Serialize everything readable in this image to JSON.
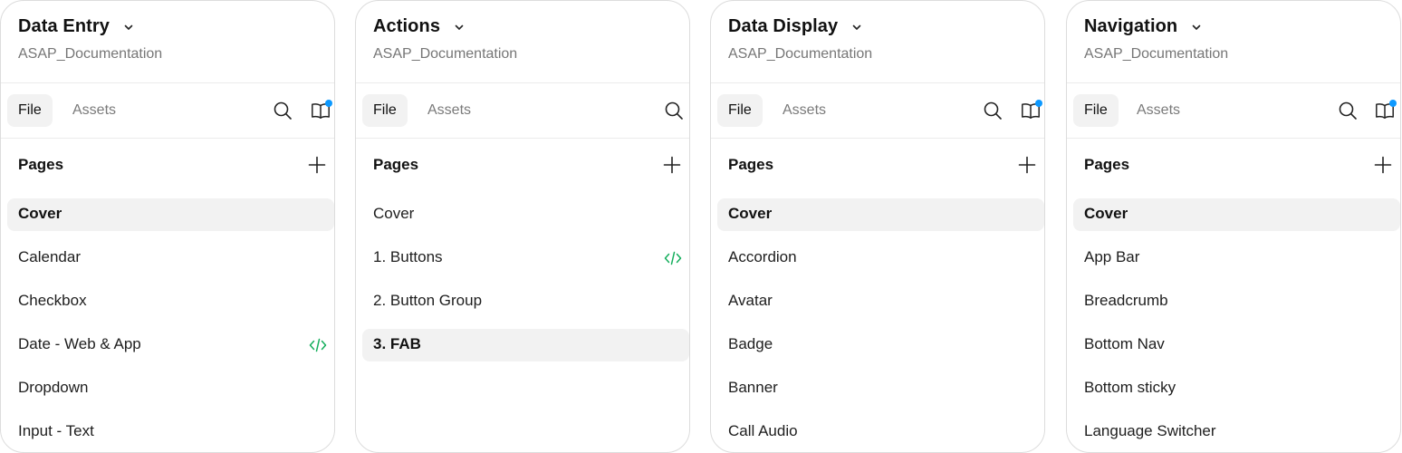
{
  "panels": [
    {
      "file_title": "Data Entry",
      "project": "ASAP_Documentation",
      "tabs": {
        "file": "File",
        "assets": "Assets"
      },
      "has_library": true,
      "pages_label": "Pages",
      "pages": [
        {
          "label": "Cover",
          "selected": true,
          "dev": false
        },
        {
          "label": "Calendar",
          "selected": false,
          "dev": false
        },
        {
          "label": "Checkbox",
          "selected": false,
          "dev": false
        },
        {
          "label": "Date - Web & App",
          "selected": false,
          "dev": true
        },
        {
          "label": "Dropdown",
          "selected": false,
          "dev": false
        },
        {
          "label": "Input - Text",
          "selected": false,
          "dev": false
        }
      ]
    },
    {
      "file_title": "Actions",
      "project": "ASAP_Documentation",
      "tabs": {
        "file": "File",
        "assets": "Assets"
      },
      "has_library": false,
      "pages_label": "Pages",
      "pages": [
        {
          "label": "Cover",
          "selected": false,
          "dev": false
        },
        {
          "label": "1. Buttons",
          "selected": false,
          "dev": true
        },
        {
          "label": "2. Button Group",
          "selected": false,
          "dev": false
        },
        {
          "label": "3. FAB",
          "selected": true,
          "dev": false
        }
      ]
    },
    {
      "file_title": "Data Display",
      "project": "ASAP_Documentation",
      "tabs": {
        "file": "File",
        "assets": "Assets"
      },
      "has_library": true,
      "pages_label": "Pages",
      "pages": [
        {
          "label": "Cover",
          "selected": true,
          "dev": false
        },
        {
          "label": "Accordion",
          "selected": false,
          "dev": false
        },
        {
          "label": "Avatar",
          "selected": false,
          "dev": false
        },
        {
          "label": "Badge",
          "selected": false,
          "dev": false
        },
        {
          "label": "Banner",
          "selected": false,
          "dev": false
        },
        {
          "label": "Call Audio",
          "selected": false,
          "dev": false
        }
      ]
    },
    {
      "file_title": "Navigation",
      "project": "ASAP_Documentation",
      "tabs": {
        "file": "File",
        "assets": "Assets"
      },
      "has_library": true,
      "pages_label": "Pages",
      "pages": [
        {
          "label": "Cover",
          "selected": true,
          "dev": false
        },
        {
          "label": "App Bar",
          "selected": false,
          "dev": false
        },
        {
          "label": "Breadcrumb",
          "selected": false,
          "dev": false
        },
        {
          "label": "Bottom Nav",
          "selected": false,
          "dev": false
        },
        {
          "label": "Bottom sticky",
          "selected": false,
          "dev": false
        },
        {
          "label": "Language Switcher",
          "selected": false,
          "dev": false
        }
      ]
    }
  ],
  "icons": {
    "title_dropdown": "chevron-down-icon",
    "search": "search-icon",
    "library": "library-book-icon",
    "add_page": "plus-icon",
    "dev_mode": "code-icon"
  },
  "colors": {
    "notification_dot": "#0d99ff",
    "dev_code": "#14ae5c",
    "selected_bg": "#f2f2f2",
    "muted_text": "#767676"
  }
}
